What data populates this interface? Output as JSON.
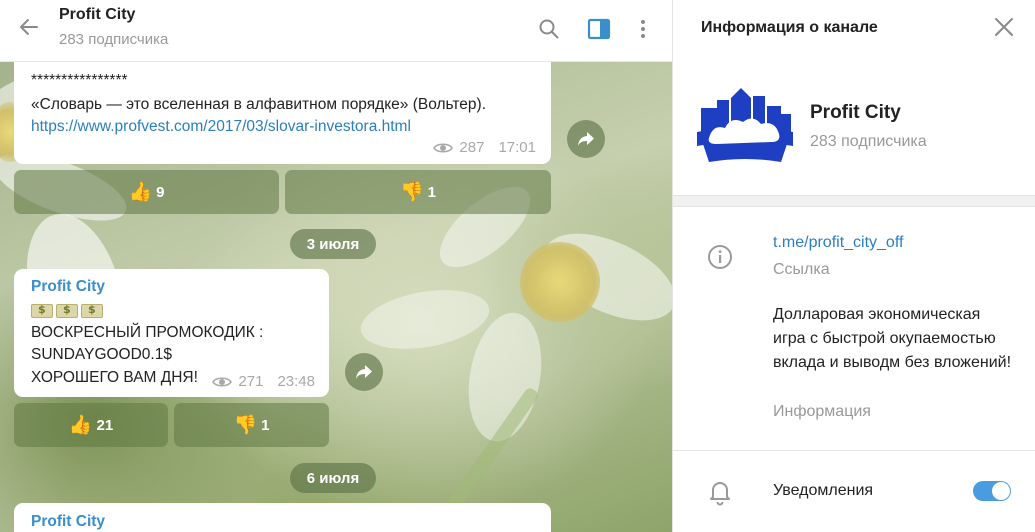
{
  "header": {
    "title": "Profit City",
    "subtitle": "283 подписчика",
    "back_icon": "arrow-left-icon",
    "icons": [
      "search-icon",
      "sidebar-toggle-icon",
      "more-vertical-icon"
    ]
  },
  "messages": [
    {
      "stars": "****************",
      "quote": "«Словарь — это вселенная в алфавитном порядке» (Вольтер).",
      "link": "https://www.profvest.com/2017/03/slovar-investora.html",
      "views": "287",
      "time": "17:01",
      "reactions": [
        {
          "emoji": "👍",
          "count": "9"
        },
        {
          "emoji": "👎",
          "count": "1"
        }
      ]
    },
    {
      "author": "Profit City",
      "line1": "ВОСКРЕСНЫЙ ПРОМОКОДИК :",
      "line2": "SUNDAYGOOD0.1$",
      "line3": "ХОРОШЕГО ВАМ ДНЯ!",
      "views": "271",
      "time": "23:48",
      "reactions": [
        {
          "emoji": "👍",
          "count": "21"
        },
        {
          "emoji": "👎",
          "count": "1"
        }
      ]
    },
    {
      "author": "Profit City"
    }
  ],
  "dates": [
    "3 июля",
    "6 июля"
  ],
  "panel": {
    "title": "Информация о канале",
    "channel_name": "Profit City",
    "subscribers": "283 подписчика",
    "link": "t.me/profit_city_off",
    "link_label": "Ссылка",
    "description": "Долларовая экономическая игра с быстрой окупаемостью вклада и выводм без вложений!",
    "description_label": "Информация",
    "notifications_label": "Уведомления",
    "notifications_on": true
  },
  "colors": {
    "accent": "#2a7fc0",
    "author": "#3a8ecc",
    "toggle": "#4a9ce0",
    "logo": "#1f3fc2"
  }
}
